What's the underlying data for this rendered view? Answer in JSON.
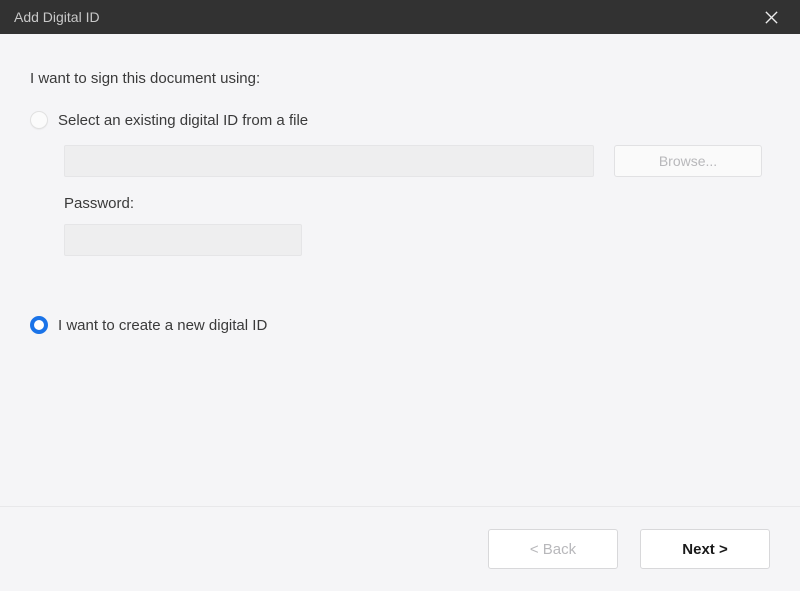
{
  "window": {
    "title": "Add Digital ID"
  },
  "content": {
    "introText": "I want to sign this document using:",
    "option1": {
      "label": "Select an existing digital ID from a file",
      "fileValue": "",
      "browseLabel": "Browse...",
      "passwordLabel": "Password:",
      "passwordValue": ""
    },
    "option2": {
      "label": "I want to create a new digital ID"
    }
  },
  "footer": {
    "backLabel": "< Back",
    "nextLabel": "Next >"
  }
}
